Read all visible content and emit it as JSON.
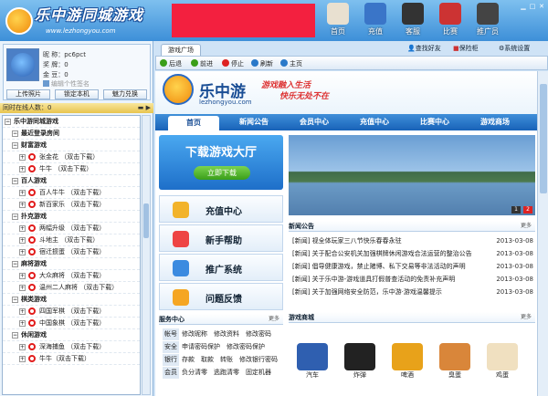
{
  "app": {
    "brand": "乐中游同城游戏",
    "brand_url": "www.lezhongyou.com"
  },
  "nav": [
    {
      "label": "首页",
      "color": "#e8e0d0"
    },
    {
      "label": "充值",
      "color": "#3a75c8"
    },
    {
      "label": "客服",
      "color": "#333"
    },
    {
      "label": "比赛",
      "color": "#c33"
    },
    {
      "label": "推广员",
      "color": "#444"
    }
  ],
  "profile": {
    "nick_label": "昵 称：",
    "nick": "pc6pct",
    "medal_label": "奖 牌：",
    "medal": "0",
    "gold_label": "金 豆：",
    "gold": "0",
    "sign_placeholder": "编辑个性签名",
    "buttons": [
      "上传照片",
      "锁定本机",
      "魅力兑换"
    ]
  },
  "online": {
    "label": "同时在线人数：",
    "count": "0"
  },
  "tree": [
    {
      "t": "乐中游同城游戏",
      "lvl": 0,
      "bold": true
    },
    {
      "t": "最近登录房间",
      "lvl": 1,
      "bold": true
    },
    {
      "t": "财富游戏",
      "lvl": 1,
      "bold": true
    },
    {
      "t": "张金花 （双击下载）",
      "lvl": 2
    },
    {
      "t": "牛牛 （双击下载）",
      "lvl": 2
    },
    {
      "t": "百人游戏",
      "lvl": 1,
      "bold": true
    },
    {
      "t": "百人牛牛 （双击下载）",
      "lvl": 2
    },
    {
      "t": "新百家乐 （双击下载）",
      "lvl": 2
    },
    {
      "t": "扑克游戏",
      "lvl": 1,
      "bold": true
    },
    {
      "t": "两幅升级 （双击下载）",
      "lvl": 2
    },
    {
      "t": "斗地主 （双击下载）",
      "lvl": 2
    },
    {
      "t": "宿迁掼蛋 （双击下载）",
      "lvl": 2
    },
    {
      "t": "麻将游戏",
      "lvl": 1,
      "bold": true
    },
    {
      "t": "大众麻将 （双击下载）",
      "lvl": 2
    },
    {
      "t": "温州二人麻将 （双击下载）",
      "lvl": 2
    },
    {
      "t": "棋类游戏",
      "lvl": 1,
      "bold": true
    },
    {
      "t": "四国军棋 （双击下载）",
      "lvl": 2
    },
    {
      "t": "中国象棋 （双击下载）",
      "lvl": 2
    },
    {
      "t": "休闲游戏",
      "lvl": 1,
      "bold": true
    },
    {
      "t": "深海捕鱼 （双击下载）",
      "lvl": 2
    },
    {
      "t": "牛牛（双击下载）",
      "lvl": 2
    }
  ],
  "browser": {
    "tab": "游戏广场",
    "right": [
      "查找好友",
      "保险柜",
      "系统设置"
    ],
    "toolbar": [
      "后退",
      "前进",
      "停止",
      "刷新",
      "主页"
    ]
  },
  "site": {
    "title": "乐中游",
    "url": "lezhongyou.com",
    "slogan1": "游戏融入生活",
    "slogan2": "快乐无处不在",
    "nav": [
      "首页",
      "新闻公告",
      "会员中心",
      "充值中心",
      "比赛中心",
      "游戏商场"
    ],
    "download": "下载游戏大厅",
    "download_btn": "立即下载",
    "menus": [
      {
        "t": "充值中心",
        "c": "#f2b32a"
      },
      {
        "t": "新手帮助",
        "c": "#e44"
      },
      {
        "t": "推广系统",
        "c": "#3c8be0"
      },
      {
        "t": "问题反馈",
        "c": "#f5a623"
      }
    ],
    "slides": [
      "1",
      "2"
    ],
    "news_title": "新闻公告",
    "more": "更多",
    "news": [
      {
        "t": "[新闻] 视全体玩家三八节快乐春春永驻",
        "d": "2013-03-08"
      },
      {
        "t": "[新闻] 关于配合公安机关加强棋牌休闲游戏合法运营的整治公告",
        "d": "2013-03-08"
      },
      {
        "t": "[新闻] 倡导健康游戏，禁止赌博、私下交易等非法活动的声明",
        "d": "2013-03-08"
      },
      {
        "t": "[新闻] 关于乐中游-游戏道具打假普查活动的免责补充声明",
        "d": "2013-03-08"
      },
      {
        "t": "[新闻] 关于加强网络安全防范，乐中游·游戏温馨提示",
        "d": "2013-03-08"
      }
    ],
    "svc_title": "服务中心",
    "svc": [
      {
        "k": "帐号",
        "v": "修改昵称　修改资料　修改密码"
      },
      {
        "k": "安全",
        "v": "申请密码保护　修改密码保护"
      },
      {
        "k": "银行",
        "v": "存款　取款　转账　修改银行密码"
      },
      {
        "k": "会员",
        "v": "负分清零　逃跑清零　固定机器"
      }
    ],
    "shop_title": "游戏商城",
    "products": [
      {
        "t": "汽车",
        "c": "#2f5fb0"
      },
      {
        "t": "炸弹",
        "c": "#222"
      },
      {
        "t": "啤酒",
        "c": "#e8a21a"
      },
      {
        "t": "臭蛋",
        "c": "#d9863a"
      },
      {
        "t": "鸡蛋",
        "c": "#f0e0c0"
      }
    ]
  }
}
